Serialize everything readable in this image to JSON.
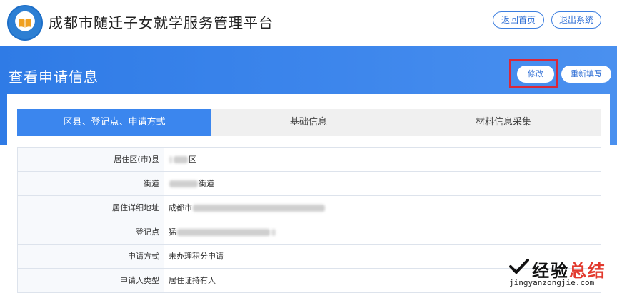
{
  "header": {
    "site_title": "成都市随迁子女就学服务管理平台",
    "home_button": "返回首页",
    "exit_button": "退出系统",
    "logo_icon": "school-logo-icon"
  },
  "banner": {
    "page_title": "查看申请信息",
    "edit_button": "修改",
    "refill_button": "重新填写",
    "highlight_color": "#d9283a",
    "accent_color": "#3b86ee"
  },
  "tabs": [
    {
      "label": "区县、登记点、申请方式",
      "active": true
    },
    {
      "label": "基础信息",
      "active": false
    },
    {
      "label": "材料信息采集",
      "active": false
    }
  ],
  "info_rows": [
    {
      "label": "居住区(市)县",
      "prefix": "",
      "suffix": "区"
    },
    {
      "label": "街道",
      "prefix": "",
      "suffix": "街道"
    },
    {
      "label": "居住详细地址",
      "prefix": "成都市",
      "suffix": ""
    },
    {
      "label": "登记点",
      "prefix": "猛",
      "suffix": ""
    },
    {
      "label": "申请方式",
      "prefix": "未办理积分申请",
      "suffix": ""
    },
    {
      "label": "申请人类型",
      "prefix": "居住证持有人",
      "suffix": ""
    }
  ],
  "watermark": {
    "text_cn_1": "经验",
    "text_cn_2": "总结",
    "url": "jingyanzongjie.com"
  }
}
